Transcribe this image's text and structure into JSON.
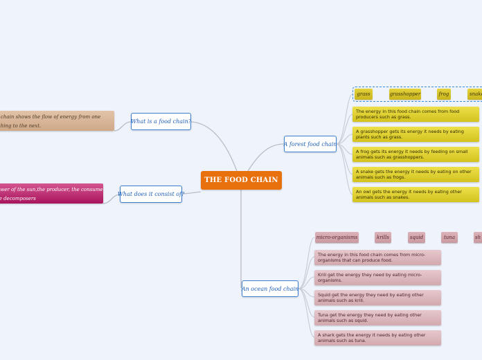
{
  "central_topic": "THE FOOD CHAIN",
  "colors": {
    "background": "#eff3fc",
    "central": "#e8710e",
    "topic_border": "#3a7fd0",
    "forest_tag": "#dccb30",
    "ocean_tag": "#d4a8ae",
    "note_tan": "#d6b394",
    "note_pink": "#b82468",
    "connector": "#b8bcc4"
  },
  "left_branches": [
    {
      "label": "What is a food chain?",
      "note": {
        "line1": "A food chain shows the flow of energy from one",
        "line2": "living thing to the next."
      }
    },
    {
      "label": "What does it consist of?",
      "note": {
        "line1": "The power of the sun,the producer, the consumer",
        "line2": "and the decomposers"
      }
    }
  ],
  "forest": {
    "label": "A forest food chain",
    "chain": [
      "grass",
      "grasshopper",
      "frog",
      "snake"
    ],
    "facts": [
      {
        "line1": "The energy in this food chain comes from food",
        "line2": "producers such as grass."
      },
      {
        "line1": "A grasshopper gets its energy it needs by eating",
        "line2": "plants such as grass."
      },
      {
        "line1": "A frog gets its energy it needs by feeding on small",
        "line2": "animals such as grasshoppers."
      },
      {
        "line1": "A snake gets the energy it needs by eating on other",
        "line2": "animals such as frogs."
      },
      {
        "line1": "An owl gets the energy it needs by eating other",
        "line2": "animals such as snakes."
      }
    ]
  },
  "ocean": {
    "label": "An ocean food chain",
    "chain": [
      "micro-organisms",
      "krills",
      "squid",
      "tuna",
      "sh"
    ],
    "facts": [
      {
        "line1": "The energy in this food chain comes from micro-",
        "line2": "organisms that can produce food."
      },
      {
        "line1": "Krill get the energy they need by eating micro-",
        "line2": "organisms."
      },
      {
        "line1": "Squid get the energy they need by eating other",
        "line2": "animals such as krill."
      },
      {
        "line1": "Tuna get the energy they need by eating other",
        "line2": "animals such as squid."
      },
      {
        "line1": "A shark gets the energy it needs by eating other",
        "line2": "animals such as tuna."
      }
    ]
  }
}
